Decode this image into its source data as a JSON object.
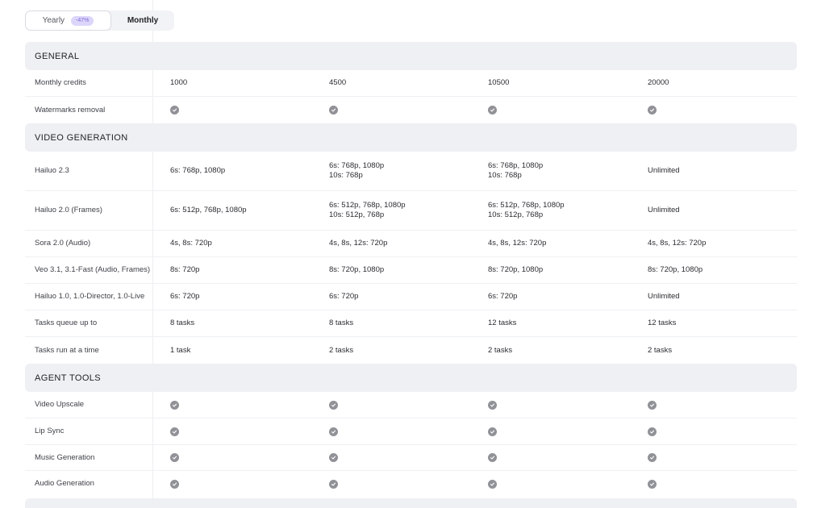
{
  "billing_toggle": {
    "yearly_label": "Yearly",
    "yearly_badge": "-47%",
    "monthly_label": "Monthly",
    "selected": "Monthly"
  },
  "colors": {
    "section_bg": "#eff0f4",
    "check_icon": "#909297",
    "badge_bg": "#ddd6fb",
    "badge_text": "#7c6bd6"
  },
  "sections": {
    "general": {
      "title": "GENERAL",
      "rows": {
        "monthly_credits": {
          "label": "Monthly credits",
          "values": [
            "1000",
            "4500",
            "10500",
            "20000"
          ]
        },
        "watermarks_removal": {
          "label": "Watermarks removal",
          "values": [
            "check-icon",
            "check-icon",
            "check-icon",
            "check-icon"
          ]
        }
      }
    },
    "video_generation": {
      "title": "VIDEO GENERATION",
      "rows": {
        "hailuo_23": {
          "label": "Hailuo 2.3",
          "values": [
            "6s: 768p, 1080p",
            "6s: 768p, 1080p\n10s: 768p",
            "6s: 768p, 1080p\n10s: 768p",
            "Unlimited"
          ]
        },
        "hailuo_20_frames": {
          "label": "Hailuo 2.0 (Frames)",
          "values": [
            "6s: 512p, 768p, 1080p",
            "6s: 512p, 768p, 1080p\n10s: 512p, 768p",
            "6s: 512p, 768p, 1080p\n10s: 512p, 768p",
            "Unlimited"
          ]
        },
        "sora_20_audio": {
          "label": "Sora 2.0 (Audio)",
          "values": [
            "4s, 8s: 720p",
            "4s, 8s, 12s: 720p",
            "4s, 8s, 12s: 720p",
            "4s, 8s, 12s: 720p"
          ]
        },
        "veo_31": {
          "label": "Veo 3.1, 3.1-Fast (Audio, Frames)",
          "values": [
            "8s: 720p",
            "8s: 720p, 1080p",
            "8s: 720p, 1080p",
            "8s: 720p, 1080p"
          ]
        },
        "hailuo_10": {
          "label": "Hailuo 1.0, 1.0-Director, 1.0-Live",
          "values": [
            "6s: 720p",
            "6s: 720p",
            "6s: 720p",
            "Unlimited"
          ]
        },
        "tasks_queue": {
          "label": "Tasks queue up to",
          "values": [
            "8 tasks",
            "8 tasks",
            "12 tasks",
            "12 tasks"
          ]
        },
        "tasks_run": {
          "label": "Tasks run at a time",
          "values": [
            "1 task",
            "2 tasks",
            "2 tasks",
            "2 tasks"
          ]
        }
      }
    },
    "agent_tools": {
      "title": "AGENT TOOLS",
      "rows": {
        "video_upscale": {
          "label": "Video Upscale",
          "values": [
            "check-icon",
            "check-icon",
            "check-icon",
            "check-icon"
          ]
        },
        "lip_sync": {
          "label": "Lip Sync",
          "values": [
            "check-icon",
            "check-icon",
            "check-icon",
            "check-icon"
          ]
        },
        "music_generation": {
          "label": "Music Generation",
          "values": [
            "check-icon",
            "check-icon",
            "check-icon",
            "check-icon"
          ]
        },
        "audio_generation": {
          "label": "Audio Generation",
          "values": [
            "check-icon",
            "check-icon",
            "check-icon",
            "check-icon"
          ]
        }
      }
    }
  }
}
